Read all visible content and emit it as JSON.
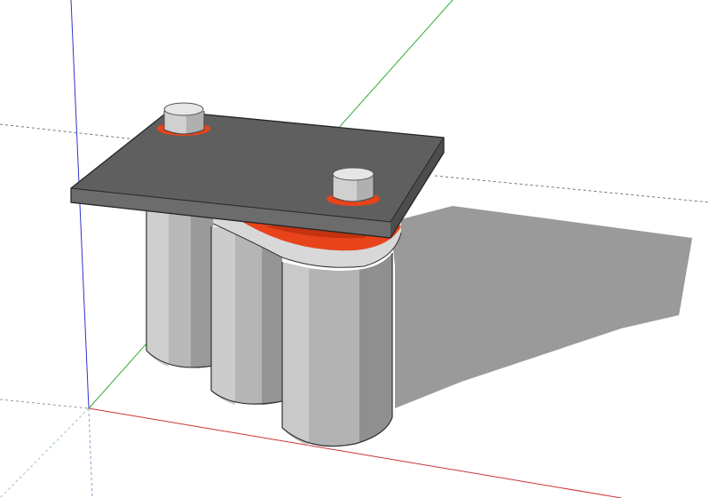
{
  "scene": {
    "description_free": true,
    "colors": {
      "background": "#ffffff",
      "plate_top": "#5f5f5f",
      "plate_front": "#6c6c6c",
      "plate_side": "#4d4d4d",
      "plate_edge": "#262626",
      "cylinder_light": "#c8c8c8",
      "cylinder_mid": "#b1b1b1",
      "cylinder_dark": "#8e8e8e",
      "terminal_top": "#e0e0e0",
      "terminal_side": "#cfcfcf",
      "red_band": "#e8431a",
      "red_band_dark": "#c43210",
      "shadow": "#9a9a9a",
      "axis_red": "#cc3333",
      "axis_green": "#33aa33",
      "axis_blue": "#3333cc",
      "axis_dashed": "#555555"
    },
    "axes": [
      "red-axis",
      "green-axis",
      "blue-axis"
    ],
    "parts": [
      "top-plate",
      "terminal-left",
      "terminal-right",
      "cylinder-left",
      "cylinder-middle",
      "cylinder-right",
      "red-band",
      "shadow"
    ]
  }
}
